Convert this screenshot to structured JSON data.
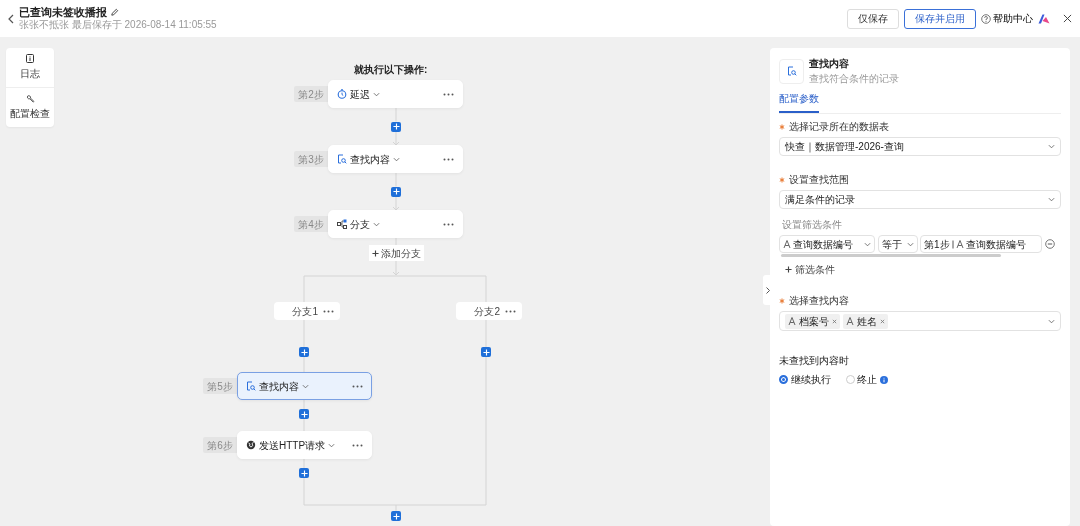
{
  "header": {
    "title": "已查询未签收播报",
    "subtitle": "张张不抵张 最后保存于 2026-08-14 11:05:55",
    "buttons": [
      {
        "label": "仅保存",
        "kind": "plain"
      },
      {
        "label": "保存并启用",
        "kind": "primary"
      }
    ],
    "help": "帮助中心"
  },
  "toolbar": [
    {
      "label": "日志",
      "kind": "log"
    },
    {
      "label": "配置检查",
      "kind": "check"
    }
  ],
  "flow": {
    "heading": "就执行以下操作:",
    "steps": [
      {
        "step": "第2步",
        "title": "延迟",
        "kind": "delay",
        "selected": false
      },
      {
        "step": "第3步",
        "title": "查找内容",
        "kind": "find",
        "selected": false
      },
      {
        "step": "第4步",
        "title": "分支",
        "kind": "branch",
        "selected": false
      }
    ],
    "add_branch": "添加分支",
    "branches": [
      {
        "label": "分支1",
        "steps": [
          {
            "step": "第5步",
            "title": "查找内容",
            "kind": "find",
            "selected": true
          },
          {
            "step": "第6步",
            "title": "发送HTTP请求",
            "kind": "http",
            "selected": false
          }
        ]
      },
      {
        "label": "分支2"
      }
    ]
  },
  "panel": {
    "title": "查找内容",
    "subtitle": "查找符合条件的记录",
    "tabs": [
      {
        "label": "配置参数",
        "selected": true
      }
    ],
    "table_field": {
      "label": "选择记录所在的数据表",
      "required": true,
      "value": "快查｜数据管理-2026-查询"
    },
    "scope_field": {
      "label": "设置查找范围",
      "required": true,
      "value": "满足条件的记录"
    },
    "conditions": {
      "label": "设置筛选条件",
      "rows": [
        {
          "field": "查询数据编号",
          "operator": "等于",
          "value_step": "第1步",
          "value_field": "查询数据编号"
        }
      ],
      "add": "筛选条件"
    },
    "content_field": {
      "label": "选择查找内容",
      "required": true,
      "tags": [
        "档案号",
        "姓名"
      ]
    },
    "not_found": {
      "label": "未查找到内容时",
      "options": [
        {
          "label": "继续执行",
          "selected": true,
          "info": false
        },
        {
          "label": "终止",
          "selected": false,
          "info": true
        }
      ]
    }
  }
}
